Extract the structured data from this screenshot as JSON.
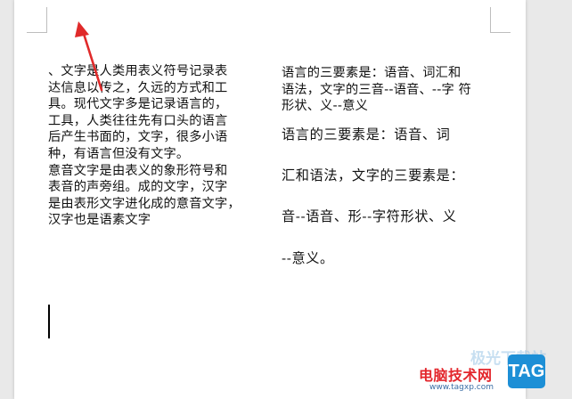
{
  "document": {
    "left_column": [
      "、文字是人类用表义符号记录表",
      "达信息以传之，久远的方式和工",
      "具。现代文字多是记录语言的，",
      "工具，人类往往先有口头的语言",
      "后产生书面的，文字，很多小语",
      "种，有语言但没有文字。",
      "意音文字是由表义的象形符号和",
      "表音的声旁组。成的文字，汉字",
      "是由表形文字进化成的意音文字，",
      "汉字也是语素文字"
    ],
    "right_column_small": [
      "语言的三要素是：语音、词汇和",
      "语法，文字的三音--语音、--字  符",
      "形状、义--意义"
    ],
    "right_column_large": [
      "语言的三要素是：语音、词",
      "汇和语法，文字的三要素是：",
      "音--语音、形--字符形状、义",
      "--意义。"
    ]
  },
  "annotation": {
    "arrow_color": "#e02a2a"
  },
  "watermark": {
    "faded_text": "极光下载站",
    "site_name": "电脑技术网",
    "url": "www.tagxp.com",
    "logo_text": "TAG"
  }
}
